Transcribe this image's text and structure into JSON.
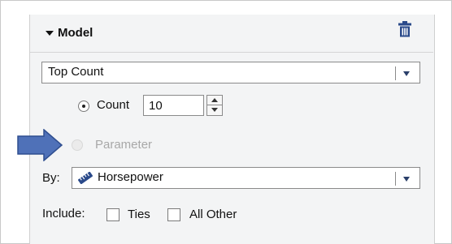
{
  "panel": {
    "title": "Model",
    "icons": {
      "collapse": "collapse-triangle-icon",
      "delete": "trash-icon",
      "pointer": "pointer-arrow-icon",
      "measure": "ruler-measure-icon"
    },
    "colors": {
      "accent": "#2a4a8a",
      "arrow": "#4f71b8",
      "panel_bg": "#f3f4f5"
    }
  },
  "model_select": {
    "value": "Top Count"
  },
  "count_option": {
    "label": "Count",
    "value": "10",
    "checked": true
  },
  "parameter_option": {
    "label": "Parameter",
    "disabled": true
  },
  "by": {
    "label": "By:",
    "value": "Horsepower"
  },
  "include": {
    "label": "Include:",
    "ties_label": "Ties",
    "ties_checked": false,
    "all_other_label": "All Other",
    "all_other_checked": false
  }
}
